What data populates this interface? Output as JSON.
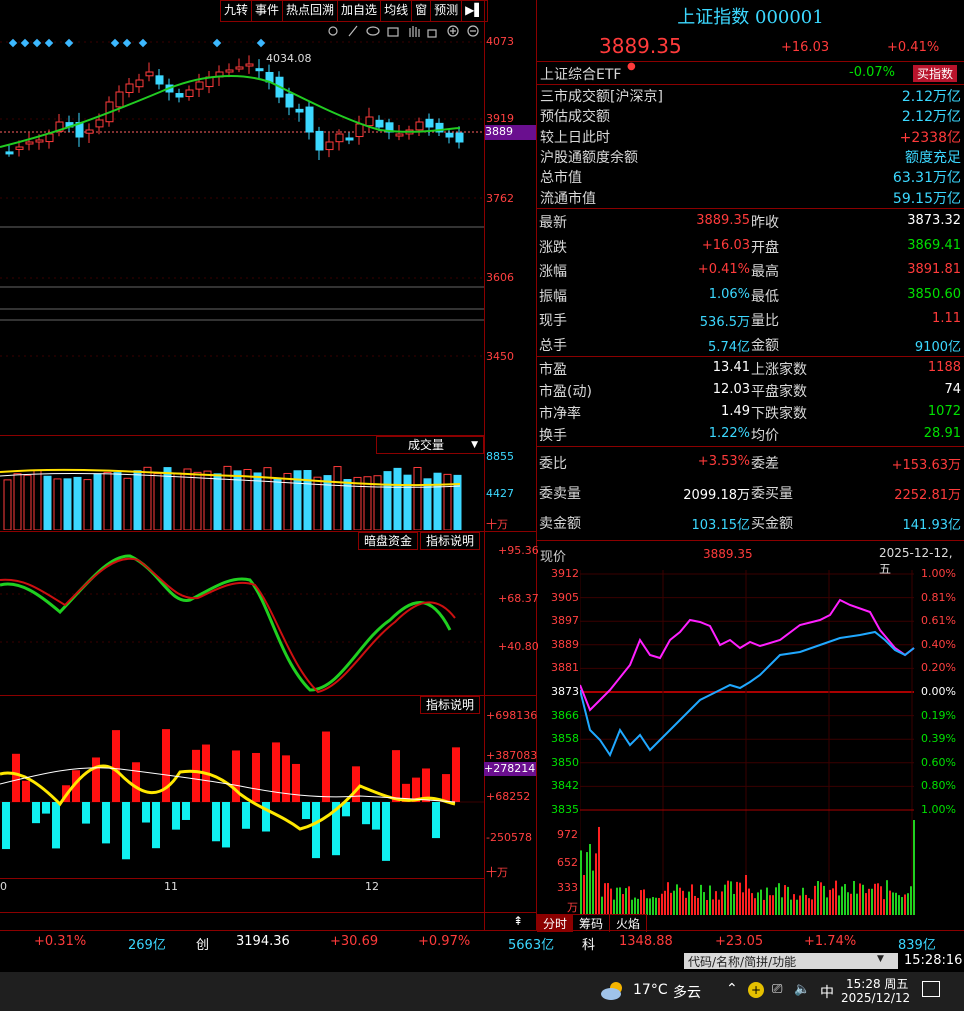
{
  "toolbar": {
    "items": [
      "九转",
      "事件",
      "热点回溯",
      "加自选",
      "均线",
      "窗",
      "预测"
    ],
    "arrow": "▶▌"
  },
  "main_chart": {
    "ma_label": "4034.08",
    "price_axis": [
      "4073",
      "3919",
      "3889",
      "3762",
      "3606",
      "3450"
    ],
    "tool_icons": [
      "gear-icon",
      "pen-icon",
      "eye-icon",
      "basket-icon",
      "hand-icon",
      "lock-icon",
      "zoom-in-icon",
      "zoom-out-icon"
    ]
  },
  "volume": {
    "selector": "成交量",
    "axis": [
      "8855",
      "4427",
      "十万"
    ]
  },
  "indicator1": {
    "btn1": "暗盘资金",
    "btn2": "指标说明",
    "axis": [
      "+95.36",
      "+68.37",
      "+40.80"
    ]
  },
  "indicator2": {
    "btn": "指标说明",
    "axis": [
      "+698136",
      "+387083",
      "+278214",
      "+68252",
      "-250578",
      "十万"
    ]
  },
  "date_axis": [
    "0",
    "11",
    "12"
  ],
  "quote": {
    "title": "上证指数 000001",
    "price": "3889.35",
    "change": "+16.03",
    "pct": "+0.41%",
    "etf_label": "上证综合ETF",
    "etf_pct": "-0.07%",
    "etf_btn": "买指数",
    "stats": [
      {
        "label": "三市成交额[沪深京]",
        "value": "2.12万亿",
        "color": "cyan"
      },
      {
        "label": "预估成交额",
        "value": "2.12万亿",
        "color": "cyan"
      },
      {
        "label": "较上日此时",
        "value": "+2338亿",
        "color": "red"
      },
      {
        "label": "沪股通额度余额",
        "value": "额度充足",
        "color": "cyan"
      },
      {
        "label": "总市值",
        "value": "63.31万亿",
        "color": "cyan"
      },
      {
        "label": "流通市值",
        "value": "59.15万亿",
        "color": "cyan"
      }
    ],
    "grid1": [
      {
        "l1": "最新",
        "v1": "3889.35",
        "c1": "red",
        "l2": "昨收",
        "v2": "3873.32",
        "c2": "white"
      },
      {
        "l1": "涨跌",
        "v1": "+16.03",
        "c1": "red",
        "l2": "开盘",
        "v2": "3869.41",
        "c2": "green"
      },
      {
        "l1": "涨幅",
        "v1": "+0.41%",
        "c1": "red",
        "l2": "最高",
        "v2": "3891.81",
        "c2": "red"
      },
      {
        "l1": "振幅",
        "v1": "1.06%",
        "c1": "cyan",
        "l2": "最低",
        "v2": "3850.60",
        "c2": "green"
      },
      {
        "l1": "现手",
        "v1": "536.5万",
        "c1": "cyan",
        "l2": "量比",
        "v2": "1.11",
        "c2": "red"
      },
      {
        "l1": "总手",
        "v1": "5.74亿",
        "c1": "cyan",
        "l2": "金额",
        "v2": "9100亿",
        "c2": "cyan"
      }
    ],
    "grid2": [
      {
        "l1": "市盈",
        "v1": "13.41",
        "c1": "white",
        "l2": "上涨家数",
        "v2": "1188",
        "c2": "red"
      },
      {
        "l1": "市盈(动)",
        "v1": "12.03",
        "c1": "white",
        "l2": "平盘家数",
        "v2": "74",
        "c2": "white"
      },
      {
        "l1": "市净率",
        "v1": "1.49",
        "c1": "white",
        "l2": "下跌家数",
        "v2": "1072",
        "c2": "green"
      },
      {
        "l1": "换手",
        "v1": "1.22%",
        "c1": "cyan",
        "l2": "均价",
        "v2": "28.91",
        "c2": "green"
      }
    ],
    "grid3": [
      {
        "l1": "委比",
        "v1": "+3.53%",
        "c1": "red",
        "l2": "委差",
        "v2": "+153.63万",
        "c2": "red"
      },
      {
        "l1": "委卖量",
        "v1": "2099.18万",
        "c1": "white",
        "l2": "委买量",
        "v2": "2252.81万",
        "c2": "red"
      },
      {
        "l1": "卖金额",
        "v1": "103.15亿",
        "c1": "cyan",
        "l2": "买金额",
        "v2": "141.93亿",
        "c2": "cyan"
      }
    ]
  },
  "intraday": {
    "label": "现价",
    "price": "3889.35",
    "date": "2025-12-12,五",
    "left_axis": [
      "3912",
      "3905",
      "3897",
      "3889",
      "3881",
      "3873",
      "3866",
      "3858",
      "3850",
      "3842",
      "3835"
    ],
    "right_axis": [
      "1.00%",
      "0.81%",
      "0.61%",
      "0.40%",
      "0.20%",
      "0.00%",
      "0.19%",
      "0.39%",
      "0.60%",
      "0.80%",
      "1.00%"
    ],
    "vol_axis": [
      "972",
      "652",
      "333",
      "万"
    ],
    "tabs": [
      "分时",
      "筹码",
      "火焰"
    ]
  },
  "bottom_bar": {
    "items": [
      {
        "t": "+0.31%",
        "c": "red"
      },
      {
        "t": "269亿",
        "c": "cyan"
      },
      {
        "t": "创",
        "c": "white"
      },
      {
        "t": "3194.36",
        "c": "white"
      },
      {
        "t": "+30.69",
        "c": "red"
      },
      {
        "t": "+0.97%",
        "c": "red"
      },
      {
        "t": "5663亿",
        "c": "cyan"
      },
      {
        "t": "科",
        "c": "white"
      },
      {
        "t": "1348.88",
        "c": "red"
      },
      {
        "t": "+23.05",
        "c": "red"
      },
      {
        "t": "+1.74%",
        "c": "red"
      },
      {
        "t": "839亿",
        "c": "cyan"
      }
    ],
    "search_placeholder": "代码/名称/简拼/功能",
    "clock": "15:28:16"
  },
  "taskbar": {
    "temp": "17°C",
    "weather": "多云",
    "ime": "中",
    "time": "15:28 周五",
    "date": "2025/12/12"
  }
}
